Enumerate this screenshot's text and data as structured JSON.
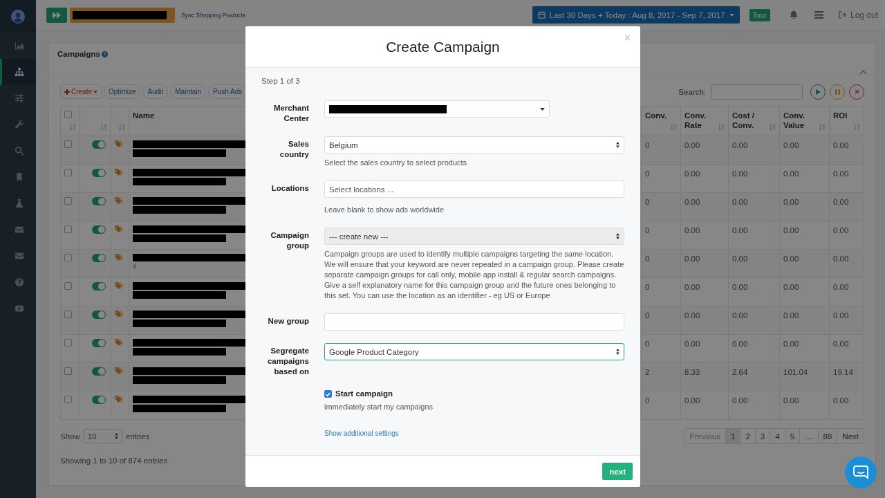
{
  "sidebar": {
    "items": [
      {
        "selected": false
      },
      {
        "selected": true
      },
      {
        "selected": false
      },
      {
        "selected": false
      },
      {
        "selected": false
      },
      {
        "selected": false
      },
      {
        "selected": false
      },
      {
        "selected": false
      },
      {
        "selected": false
      },
      {
        "selected": false
      },
      {
        "selected": false
      }
    ]
  },
  "header": {
    "sync_label": "Sync Shopping Products",
    "date_range": "Last 30 Days + Today : Aug 8, 2017 - Sep 7, 2017",
    "tour": "Tour",
    "logout": "Log out"
  },
  "panel": {
    "title": "Campaigns",
    "toolbar": [
      {
        "label": "Create",
        "kind": "dropdown"
      },
      {
        "label": "Optimize",
        "kind": "pill"
      },
      {
        "label": "Audit",
        "kind": "pill"
      },
      {
        "label": "Maintain",
        "kind": "pill"
      },
      {
        "label": "Push Ads",
        "kind": "pill"
      }
    ],
    "search": {
      "label": "Search:"
    },
    "table": {
      "header_checkbox": {
        "checked": false
      },
      "columns": [
        "Name",
        "Conv.",
        "Conv. Rate",
        "Cost / Conv.",
        "Conv. Value",
        "ROI"
      ],
      "rows": [
        {
          "checked": false,
          "on": true,
          "alert": false,
          "values": [
            "0",
            "0.00",
            "0.00",
            "0.00",
            "0.00"
          ]
        },
        {
          "checked": false,
          "on": true,
          "alert": false,
          "values": [
            "0",
            "0.00",
            "0.00",
            "0.00",
            "0.00"
          ]
        },
        {
          "checked": false,
          "on": true,
          "alert": false,
          "values": [
            "0",
            "0.00",
            "0.00",
            "0.00",
            "0.00"
          ]
        },
        {
          "checked": false,
          "on": true,
          "alert": false,
          "values": [
            "0",
            "0.00",
            "0.00",
            "0.00",
            "0.00"
          ]
        },
        {
          "checked": false,
          "on": true,
          "alert": true,
          "values": [
            "0",
            "0.00",
            "0.00",
            "0.00",
            "0.00"
          ]
        },
        {
          "checked": false,
          "on": true,
          "alert": false,
          "values": [
            "0",
            "0.00",
            "0.00",
            "0.00",
            "0.00"
          ]
        },
        {
          "checked": false,
          "on": true,
          "alert": false,
          "values": [
            "0",
            "0.00",
            "0.00",
            "0.00",
            "0.00"
          ]
        },
        {
          "checked": false,
          "on": true,
          "alert": false,
          "values": [
            "0",
            "0.00",
            "0.00",
            "0.00",
            "0.00"
          ]
        },
        {
          "checked": false,
          "on": true,
          "alert": false,
          "values": [
            "2",
            "8.33",
            "2.64",
            "101.04",
            "19.14"
          ]
        },
        {
          "checked": false,
          "on": true,
          "alert": false,
          "values": [
            "0",
            "0.00",
            "0.00",
            "0.00",
            "0.00"
          ]
        }
      ]
    },
    "length_menu": {
      "before": "Show",
      "value": "10",
      "after": "entries"
    },
    "info": "Showing 1 to 10 of 874 entries",
    "pagination": [
      {
        "label": "Previous",
        "selected": false,
        "disabled": true
      },
      {
        "label": "1",
        "selected": true,
        "disabled": false
      },
      {
        "label": "2",
        "selected": false,
        "disabled": false
      },
      {
        "label": "3",
        "selected": false,
        "disabled": false
      },
      {
        "label": "4",
        "selected": false,
        "disabled": false
      },
      {
        "label": "5",
        "selected": false,
        "disabled": false
      },
      {
        "label": "…",
        "selected": false,
        "disabled": false
      },
      {
        "label": "88",
        "selected": false,
        "disabled": false
      },
      {
        "label": "Next",
        "selected": false,
        "disabled": false
      }
    ]
  },
  "modal": {
    "title": "Create Campaign",
    "close": "×",
    "step": "Step 1 of 3",
    "fields": [
      {
        "kind": "dropdown",
        "label": "Merchant Center",
        "disabled": false,
        "focused": false
      },
      {
        "kind": "select",
        "label": "Sales country",
        "value": "Belgium",
        "help": "Select the sales country to select products",
        "disabled": false,
        "focused": false
      },
      {
        "kind": "input",
        "label": "Locations",
        "placeholder": "Select locations ...",
        "help": "Leave blank to show ads worldwide",
        "disabled": false,
        "focused": false
      },
      {
        "kind": "select",
        "label": "Campaign group",
        "value": "--- create new ---",
        "help": "Campaign groups are used to identify multiple campaigns targeting the same location. We will ensure that your keyword are never repeated in a campaign group. Please create separate campaign groups for call only, mobile app install & regular search campaigns. Give a self explanatory name for this campaign group and the future ones belonging to this set. You can use the location as an identifier - eg US or Europe",
        "disabled": true,
        "focused": false
      },
      {
        "kind": "input",
        "label": "New group",
        "disabled": false,
        "focused": false
      },
      {
        "kind": "select",
        "label": "Segregate campaigns based on",
        "value": "Google Product Category",
        "disabled": false,
        "focused": true
      },
      {
        "kind": "checkbox",
        "label": "Start campaign",
        "checked": true,
        "help": "immediately start my campaigns",
        "disabled": false,
        "focused": false
      }
    ],
    "link": "Show additional settings",
    "submit": "next"
  }
}
